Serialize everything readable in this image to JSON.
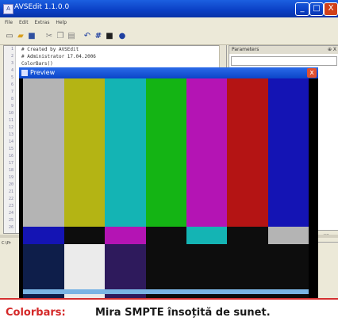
{
  "window": {
    "title": "AVSEdit 1.1.0.0",
    "minimize": "_",
    "maximize": "□",
    "close": "X"
  },
  "menu": [
    "File",
    "Edit",
    "Extras",
    "Help"
  ],
  "toolbar_icons": [
    "new-icon",
    "open-icon",
    "save-icon",
    "cut-icon",
    "copy-icon",
    "paste-icon",
    "undo-icon",
    "hash-icon",
    "stop-icon",
    "info-icon"
  ],
  "editor": {
    "line_numbers": [
      "1",
      "2",
      "3",
      "4",
      "5",
      "6",
      "7",
      "8",
      "9",
      "10",
      "11",
      "12",
      "13",
      "14",
      "15",
      "16",
      "17",
      "18",
      "19",
      "20",
      "21",
      "22",
      "23",
      "24",
      "25",
      "26"
    ],
    "lines": [
      "# Created by AVSEdit",
      "# Administrator 17.04.2006",
      "ColorBars()"
    ]
  },
  "parameters": {
    "label": "Parameters",
    "pin": "⊕ X"
  },
  "side_tab": "Hiles",
  "statusbar": {
    "path": "C:\\Pr"
  },
  "preview": {
    "title": "Preview",
    "close": "x"
  },
  "caption": {
    "lead": "Colorbars:",
    "text": "Mira SMPTE însoțită de sunet."
  },
  "colors": {
    "accent": "#d42828",
    "titlebar": "#0a3fc4",
    "bar_top": [
      "#b4b4b4",
      "#b4b414",
      "#14b4b4",
      "#14b414",
      "#b414b4",
      "#b41414",
      "#1414b4"
    ],
    "bar_mid": [
      "#1414b4",
      "#0d0d0d",
      "#b414b4",
      "#0d0d0d",
      "#14b4b4",
      "#0d0d0d",
      "#b4b4b4"
    ],
    "bar_low": [
      "#0e1e4a",
      "#ebebeb",
      "#2e1a5c",
      "#0d0d0d",
      "#0d0d0d",
      "#0d0d0d",
      "#0d0d0d"
    ]
  }
}
